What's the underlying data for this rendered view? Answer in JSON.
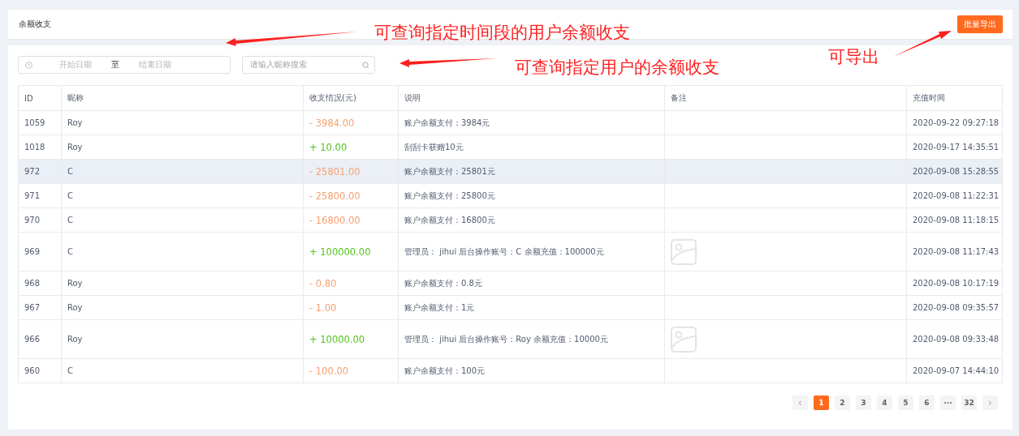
{
  "header": {
    "title": "余额收支",
    "export_button": "批量导出"
  },
  "filters": {
    "start_placeholder": "开始日期",
    "separator": "至",
    "end_placeholder": "结束日期",
    "search_placeholder": "请输入昵称搜索"
  },
  "table": {
    "columns": [
      "ID",
      "昵称",
      "收支情况(元)",
      "说明",
      "备注",
      "充值时间"
    ],
    "rows": [
      {
        "id": "1059",
        "name": "Roy",
        "amount": "- 3984.00",
        "kind": "expense",
        "desc": "账户余额支付：3984元",
        "has_image": false,
        "time": "2020-09-22 09:27:18",
        "selected": false
      },
      {
        "id": "1018",
        "name": "Roy",
        "amount": "+ 10.00",
        "kind": "income",
        "desc": "刮刮卡获赠10元",
        "has_image": false,
        "time": "2020-09-17 14:35:51",
        "selected": false
      },
      {
        "id": "972",
        "name": "C",
        "amount": "- 25801.00",
        "kind": "expense",
        "desc": "账户余额支付：25801元",
        "has_image": false,
        "time": "2020-09-08 15:28:55",
        "selected": true
      },
      {
        "id": "971",
        "name": "C",
        "amount": "- 25800.00",
        "kind": "expense",
        "desc": "账户余额支付：25800元",
        "has_image": false,
        "time": "2020-09-08 11:22:31",
        "selected": false
      },
      {
        "id": "970",
        "name": "C",
        "amount": "- 16800.00",
        "kind": "expense",
        "desc": "账户余额支付：16800元",
        "has_image": false,
        "time": "2020-09-08 11:18:15",
        "selected": false
      },
      {
        "id": "969",
        "name": "C",
        "amount": "+ 100000.00",
        "kind": "income",
        "desc": "管理员： jihui 后台操作账号：C 余额充值：100000元",
        "has_image": true,
        "time": "2020-09-08 11:17:43",
        "selected": false
      },
      {
        "id": "968",
        "name": "Roy",
        "amount": "- 0.80",
        "kind": "expense",
        "desc": "账户余额支付：0.8元",
        "has_image": false,
        "time": "2020-09-08 10:17:19",
        "selected": false
      },
      {
        "id": "967",
        "name": "Roy",
        "amount": "- 1.00",
        "kind": "expense",
        "desc": "账户余额支付：1元",
        "has_image": false,
        "time": "2020-09-08 09:35:57",
        "selected": false
      },
      {
        "id": "966",
        "name": "Roy",
        "amount": "+ 10000.00",
        "kind": "income",
        "desc": "管理员： jihui 后台操作账号：Roy 余额充值：10000元",
        "has_image": true,
        "time": "2020-09-08 09:33:48",
        "selected": false
      },
      {
        "id": "960",
        "name": "C",
        "amount": "- 100.00",
        "kind": "expense",
        "desc": "账户余额支付：100元",
        "has_image": false,
        "time": "2020-09-07 14:44:10",
        "selected": false
      }
    ]
  },
  "pagination": {
    "prev": "‹",
    "next": "›",
    "pages": [
      {
        "label": "1",
        "selected": true
      },
      {
        "label": "2",
        "selected": false
      },
      {
        "label": "3",
        "selected": false
      },
      {
        "label": "4",
        "selected": false
      },
      {
        "label": "5",
        "selected": false
      },
      {
        "label": "6",
        "selected": false
      },
      {
        "label": "···",
        "selected": false
      },
      {
        "label": "32",
        "selected": false
      }
    ]
  },
  "annotations": [
    "可查询指定时间段的用户余额收支",
    "可查询指定用户的余额收支",
    "可导出"
  ]
}
